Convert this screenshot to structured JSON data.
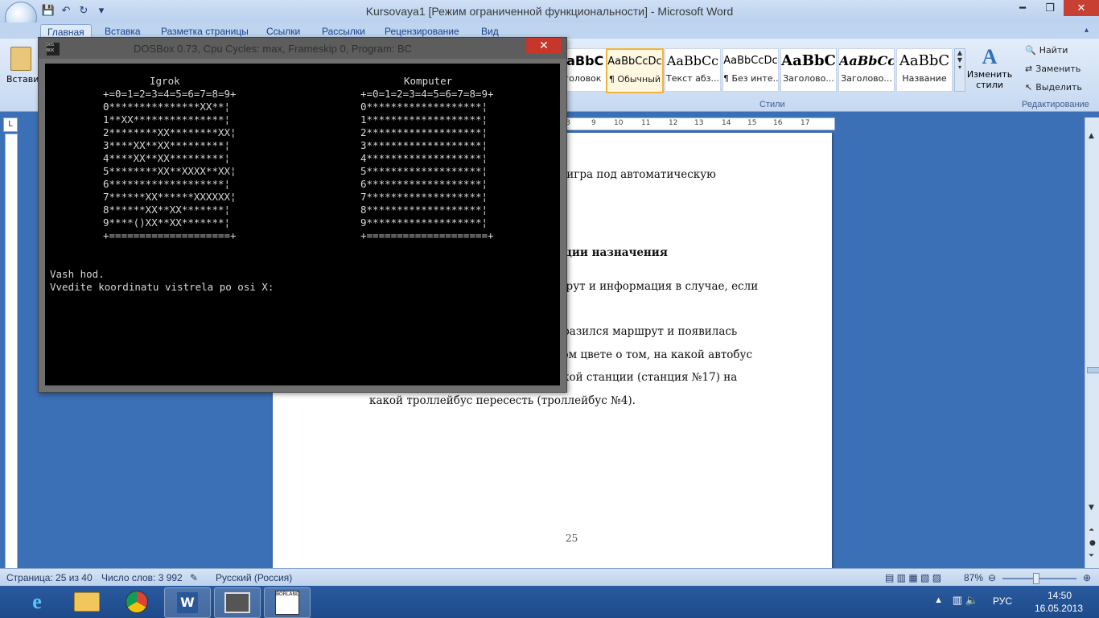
{
  "word": {
    "title": "Kursovaya1 [Режим ограниченной функциональности] - Microsoft Word",
    "tabs": [
      "Главная",
      "Вставка",
      "Разметка страницы",
      "Ссылки",
      "Рассылки",
      "Рецензирование",
      "Вид"
    ],
    "active_tab": "Главная",
    "styles": [
      {
        "sample": "AaBbC",
        "name": "аголовок"
      },
      {
        "sample": "AaBbCcDc",
        "name": "¶ Обычный"
      },
      {
        "sample": "AaBbCc",
        "name": "Текст абз..."
      },
      {
        "sample": "AaBbCcDc",
        "name": "¶ Без инте..."
      },
      {
        "sample": "AaBbC",
        "name": "Заголово..."
      },
      {
        "sample": "AaBbCc",
        "name": "Заголово..."
      },
      {
        "sample": "AaBbC",
        "name": "Название"
      }
    ],
    "change_styles_label": "Изменить стили",
    "styles_group_label": "Стили",
    "editing_group_label": "Редактирование",
    "find_label": "Найти",
    "replace_label": "Заменить",
    "select_label": "Выделить",
    "paste_label": "Встави",
    "ruler_numbers": [
      "8",
      "9",
      "10",
      "11",
      "12",
      "13",
      "14",
      "15",
      "16",
      "17"
    ],
    "ruler_corner": "L",
    "document_lines": [
      "н игра под автоматическую",
      "нции назначения",
      "шрут и информация в случае, если",
      "бразился маршрут и появилась",
      "том цвете о том, на  какой автобус",
      "акой станции  (станция №17) на",
      "какой троллейбус пересесть (троллейбус №4)."
    ],
    "page_number": "25",
    "status": {
      "page": "Страница: 25 из 40",
      "words": "Число слов: 3 992",
      "language": "Русский (Россия)",
      "zoom": "87%"
    }
  },
  "dosbox": {
    "title": "DOSBox 0.73, Cpu Cycles:      max, Frameskip  0, Program:      BC",
    "icon_text": "DOS BOX",
    "close_glyph": "✕",
    "player_label": "Igrok",
    "computer_label": "Komputer",
    "player_header": "+=0=1=2=3=4=5=6=7=8=9+",
    "player_rows": [
      "0***************XX**¦",
      "1**XX***************¦",
      "2********XX********XX¦",
      "3****XX**XX*********¦",
      "4****XX**XX*********¦",
      "5********XX**XXXX**XX¦",
      "6*******************¦",
      "7******XX******XXXXXX¦",
      "8******XX**XX*******¦",
      "9****()XX**XX*******¦"
    ],
    "computer_header": "+=0=1=2=3=4=5=6=7=8=9+",
    "computer_rows": [
      "0*******************¦",
      "1*******************¦",
      "2*******************¦",
      "3*******************¦",
      "4*******************¦",
      "5*******************¦",
      "6*******************¦",
      "7*******************¦",
      "8*******************¦",
      "9*******************¦"
    ],
    "footer": "+====================+",
    "prompt_line1": "Vash hod.",
    "prompt_line2": "Vvedite koordinatu vistrela po osi X:"
  },
  "taskbar": {
    "language": "РУС",
    "time": "14:50",
    "date": "16.05.2013",
    "borland_text": "BORLAND",
    "apps": [
      "internet-explorer-icon",
      "file-explorer-icon",
      "chrome-icon",
      "word-icon",
      "dosbox-icon",
      "borland-icon"
    ]
  }
}
